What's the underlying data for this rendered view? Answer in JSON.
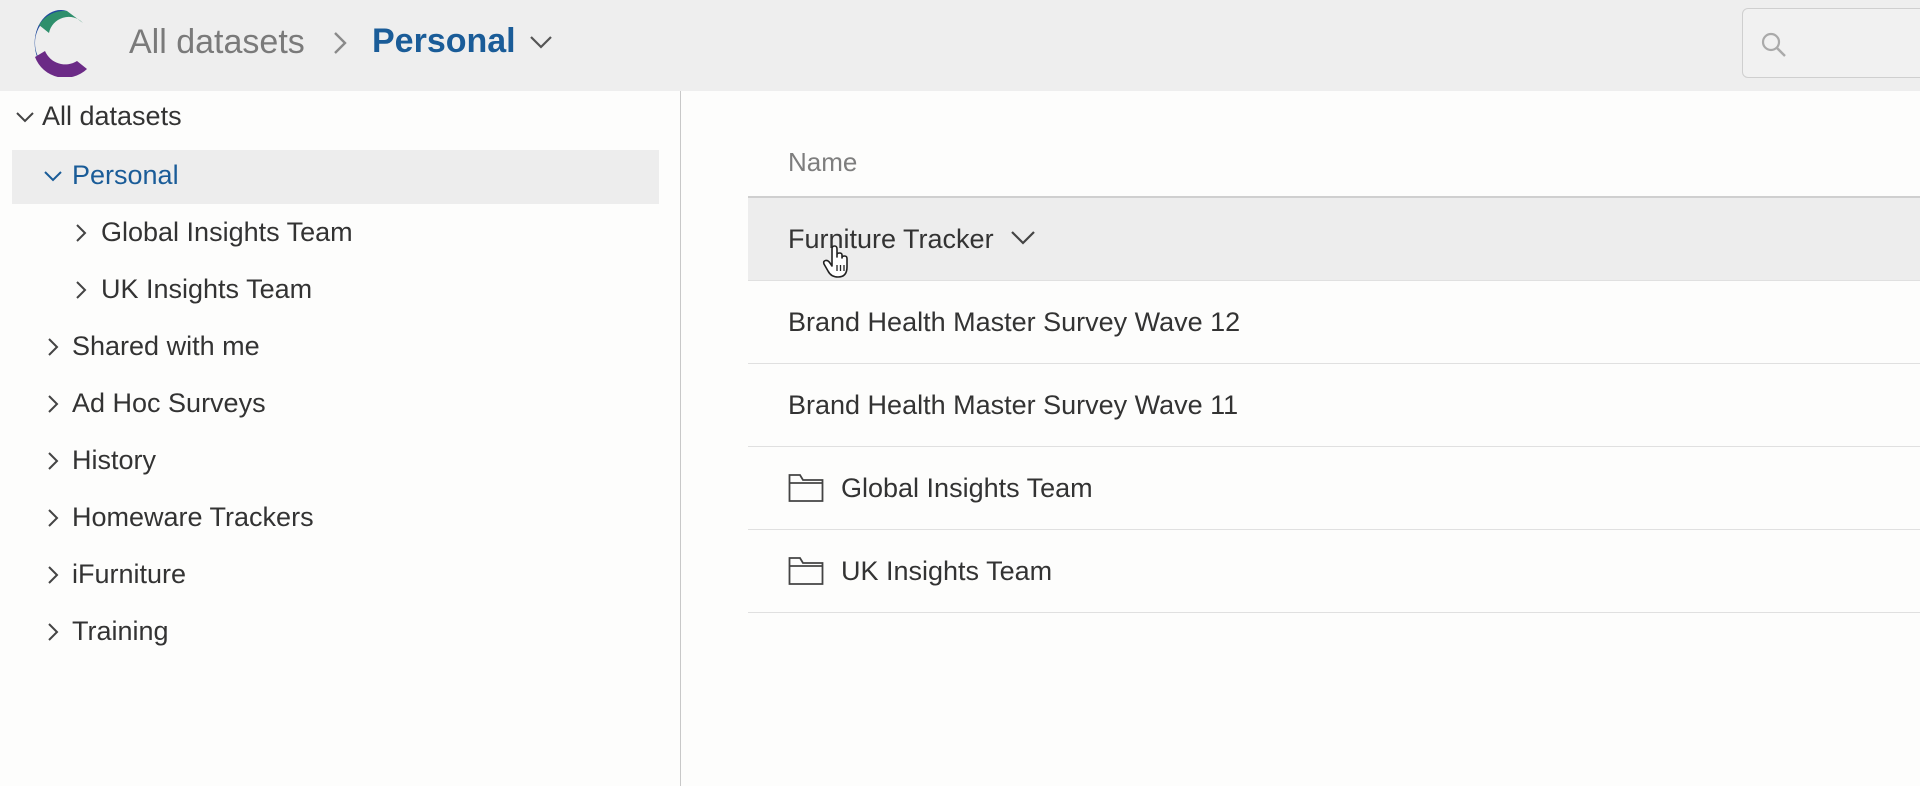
{
  "header": {
    "breadcrumb_root": "All datasets",
    "breadcrumb_current": "Personal",
    "search_placeholder": ""
  },
  "sidebar": {
    "items": [
      {
        "label": "All datasets",
        "expanded": true
      },
      {
        "label": "Personal",
        "expanded": true,
        "selected": true
      },
      {
        "label": "Global Insights Team",
        "expanded": false
      },
      {
        "label": "UK Insights Team",
        "expanded": false
      },
      {
        "label": "Shared with me",
        "expanded": false
      },
      {
        "label": "Ad Hoc Surveys",
        "expanded": false
      },
      {
        "label": "History",
        "expanded": false
      },
      {
        "label": "Homeware Trackers",
        "expanded": false
      },
      {
        "label": "iFurniture",
        "expanded": false
      },
      {
        "label": "Training",
        "expanded": false
      }
    ]
  },
  "main": {
    "column_header": "Name",
    "rows": [
      {
        "label": "Furniture Tracker",
        "type": "dataset",
        "hovered": true
      },
      {
        "label": "Brand Health Master Survey Wave 12",
        "type": "dataset"
      },
      {
        "label": "Brand Health Master Survey Wave 11",
        "type": "dataset"
      },
      {
        "label": "Global Insights Team",
        "type": "folder"
      },
      {
        "label": "UK Insights Team",
        "type": "folder"
      }
    ]
  },
  "colors": {
    "accent": "#1a5c98",
    "header_bg": "#eeeeee",
    "selected_bg": "#ededed"
  }
}
